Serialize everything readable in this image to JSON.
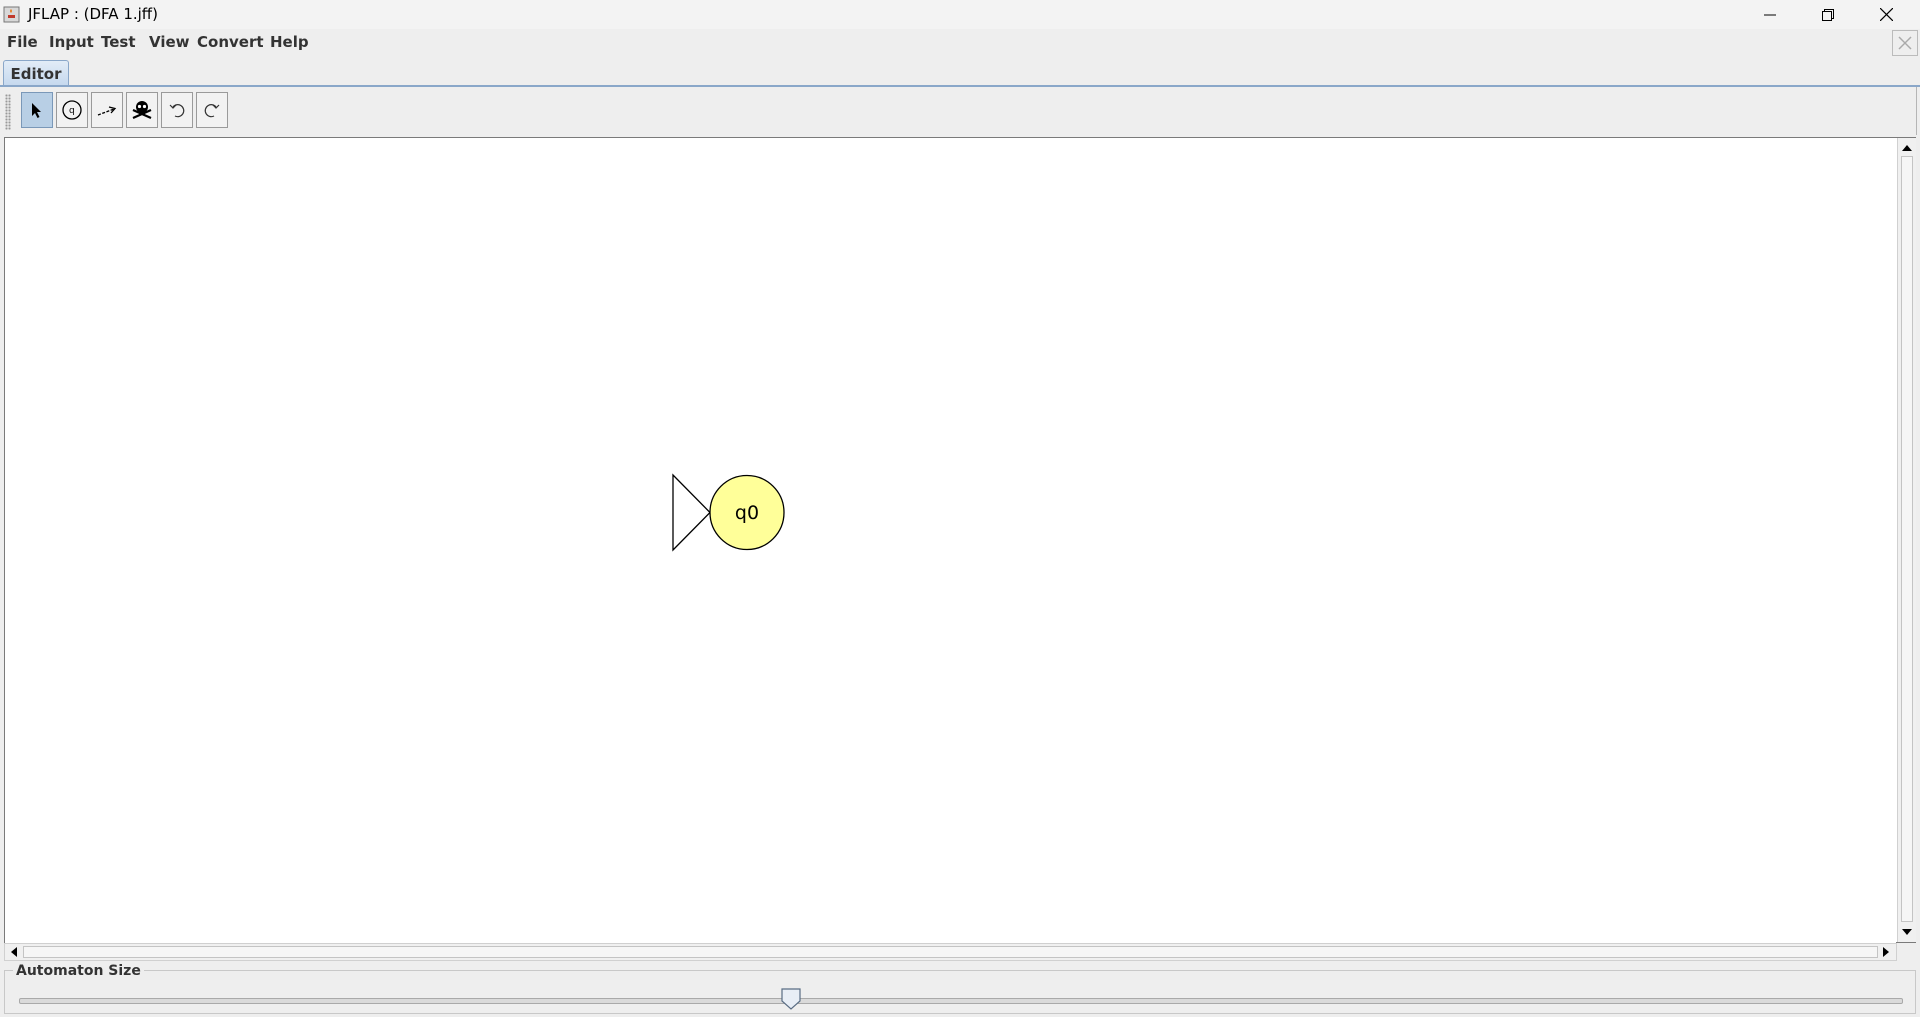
{
  "window": {
    "title": "JFLAP : (DFA 1.jff)"
  },
  "menu": {
    "items": [
      "File",
      "Input",
      "Test",
      "View",
      "Convert",
      "Help"
    ]
  },
  "tabs": [
    {
      "label": "Editor",
      "selected": true
    }
  ],
  "toolbar": {
    "tools": [
      {
        "name": "attribute-editor",
        "icon": "arrow-pointer-icon",
        "selected": true
      },
      {
        "name": "state-creator",
        "icon": "state-create-icon",
        "selected": false
      },
      {
        "name": "transition-creator",
        "icon": "transition-arrow-icon",
        "selected": false
      },
      {
        "name": "deleter",
        "icon": "skull-crossbones-icon",
        "selected": false
      },
      {
        "name": "undo",
        "icon": "undo-icon",
        "selected": false
      },
      {
        "name": "redo",
        "icon": "redo-icon",
        "selected": false
      }
    ]
  },
  "automaton": {
    "states": [
      {
        "label": "q0",
        "initial": true,
        "final": false
      }
    ],
    "state_fill": "#ffff99"
  },
  "size_panel": {
    "label": "Automaton Size",
    "slider_value": 0.41
  }
}
